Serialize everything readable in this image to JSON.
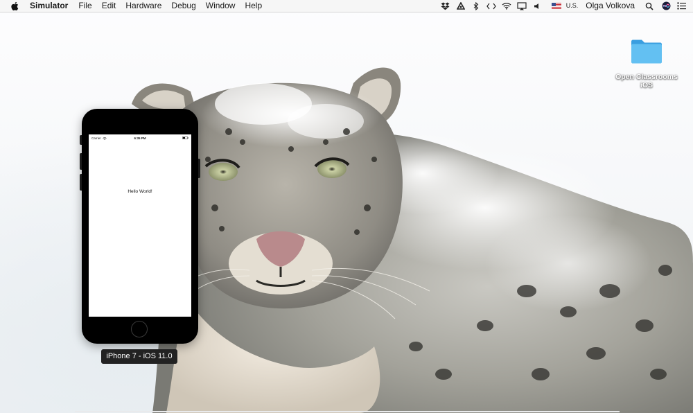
{
  "menubar": {
    "app_name": "Simulator",
    "items": [
      "File",
      "Edit",
      "Hardware",
      "Debug",
      "Window",
      "Help"
    ],
    "locale": "U.S.",
    "user_name": "Olga Volkova"
  },
  "desktop": {
    "folder_label_line1": "Open Classrooms",
    "folder_label_line2": "iOS",
    "folder_color": "#5ab9ee"
  },
  "simulator": {
    "device_label": "iPhone 7 - iOS 11.0",
    "status_carrier": "Carrier",
    "status_time": "6:35 PM",
    "screen_text": "Hello World!"
  }
}
